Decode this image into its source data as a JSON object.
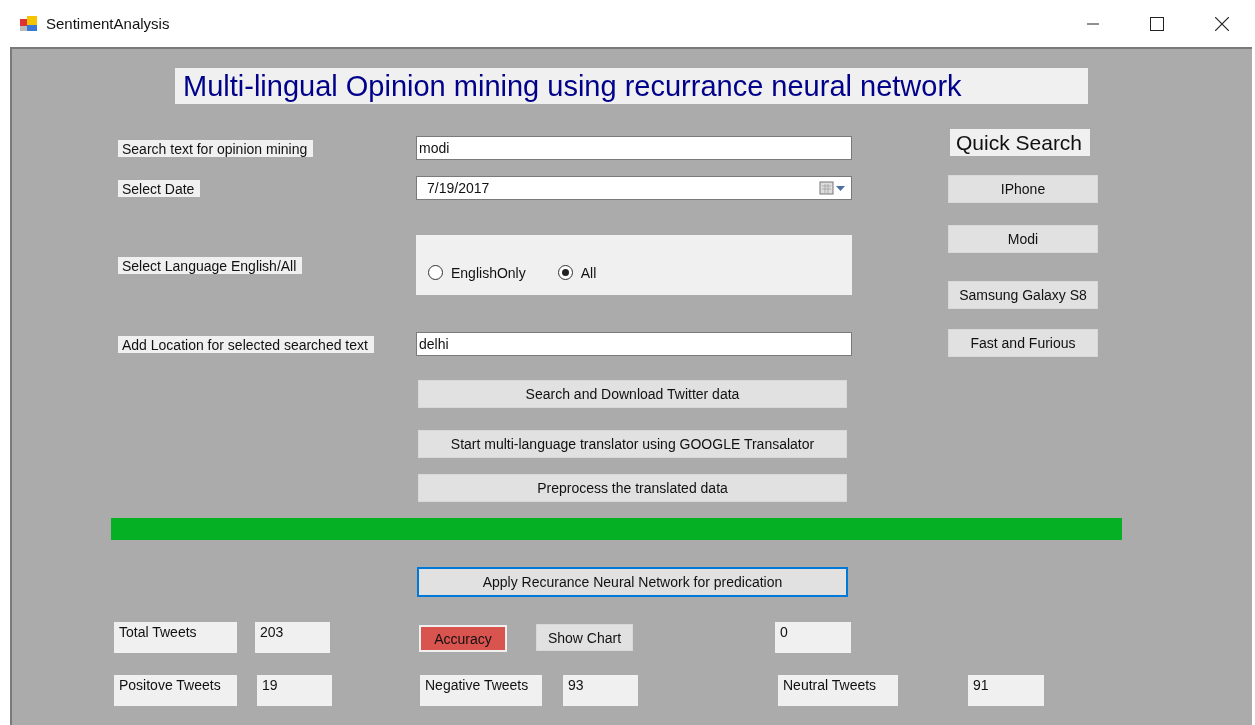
{
  "window": {
    "title": "SentimentAnalysis"
  },
  "heading": "Multi-lingual Opinion mining using recurrance neural network",
  "form": {
    "search_label": "Search text for opinion mining",
    "search_value": "modi",
    "date_label": "Select Date",
    "date_value": "7/19/2017",
    "language_label": "Select Language English/All",
    "language_options": [
      {
        "label": "EnglishOnly",
        "selected": false
      },
      {
        "label": "All",
        "selected": true
      }
    ],
    "location_label": "Add Location for selected searched text",
    "location_value": "delhi"
  },
  "actions": [
    "Search and Download Twitter data",
    "Start multi-language translator using GOOGLE Transalator",
    "Preprocess the translated data"
  ],
  "quick_search": {
    "title": "Quick Search",
    "items": [
      "IPhone",
      "Modi",
      "Samsung Galaxy S8",
      "Fast and Furious"
    ]
  },
  "progress": {
    "level": 1
  },
  "apply_button": {
    "label": "Apply Recurance Neural Network for predication",
    "focused": true
  },
  "stats": {
    "total_label": "Total Tweets",
    "total_value": "203",
    "accuracy_button": "Accuracy",
    "chart_button": "Show Chart",
    "accuracy_value": "0",
    "positive_label": "Positove Tweets",
    "positive_value": "19",
    "negative_label": "Negative Tweets",
    "negative_value": "93",
    "neutral_label": "Neutral Tweets",
    "neutral_value": "91"
  }
}
